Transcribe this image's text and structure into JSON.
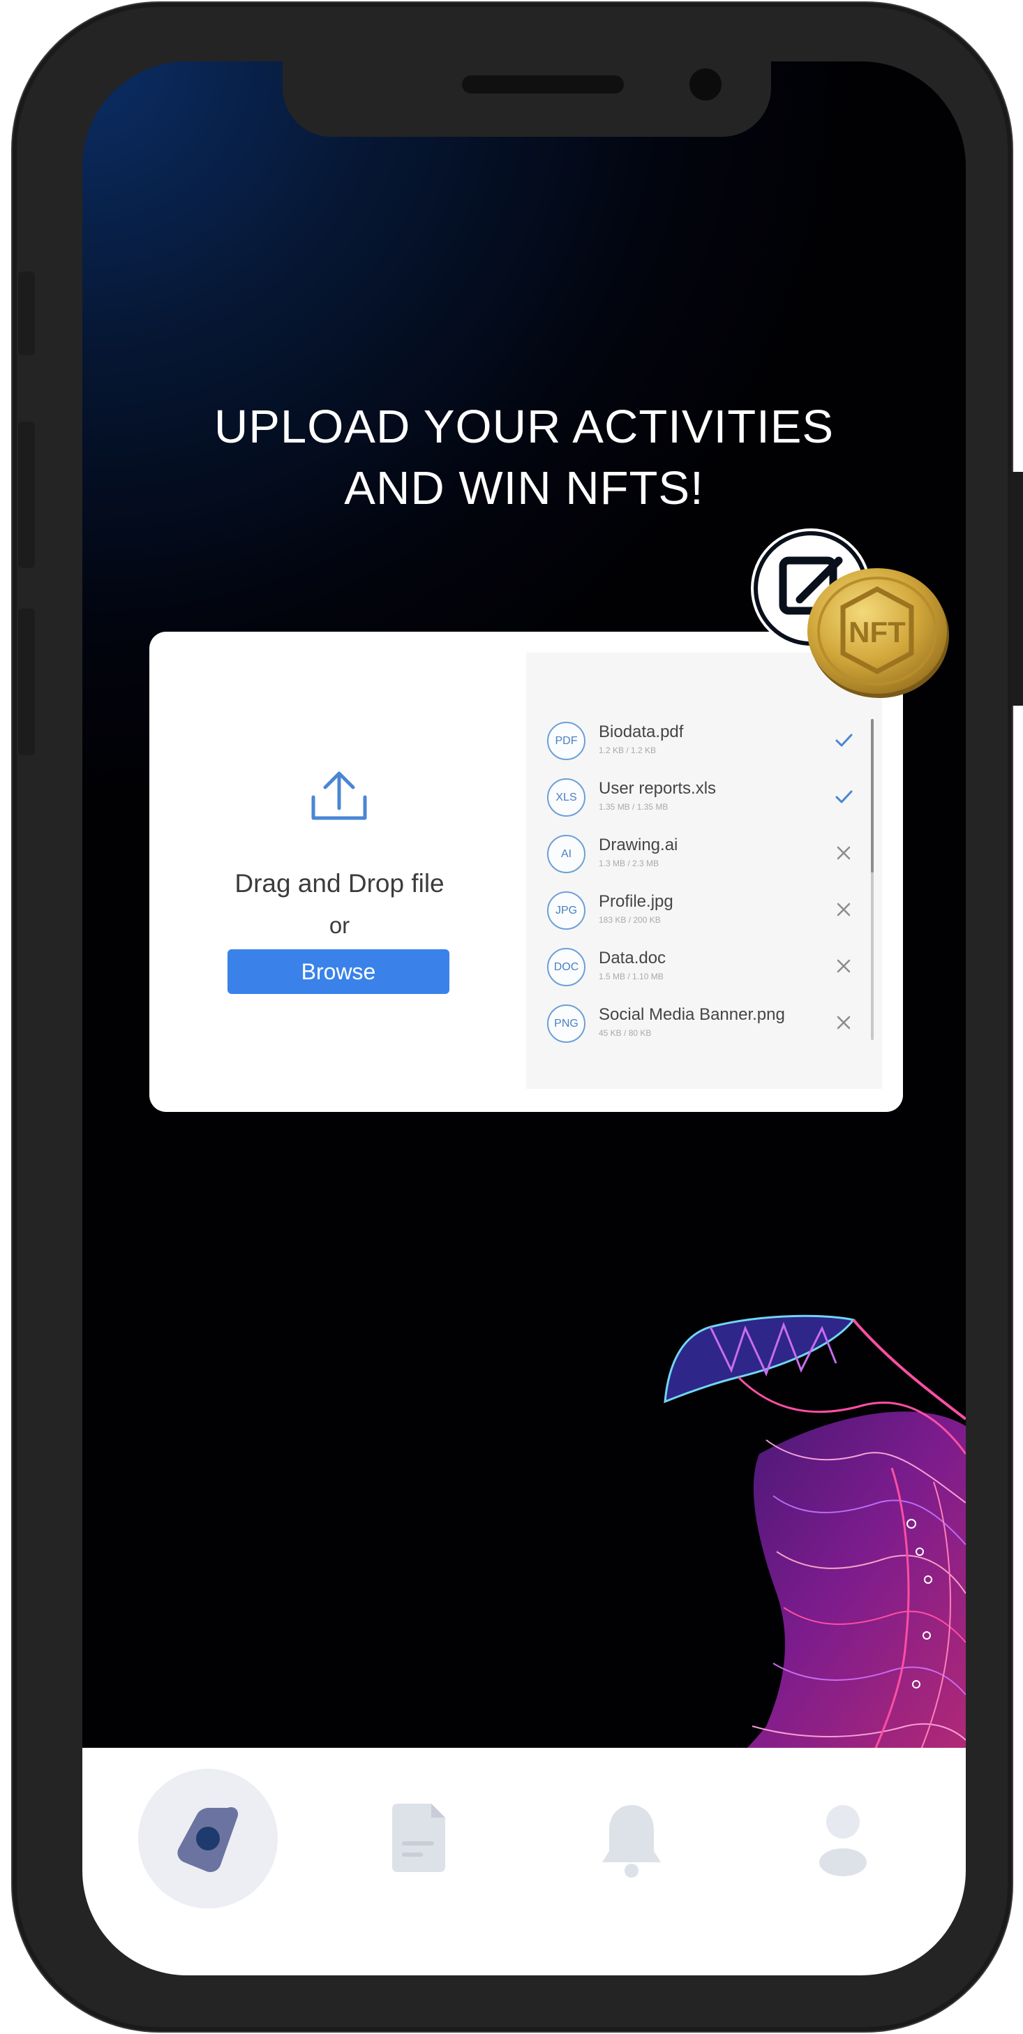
{
  "headline": {
    "line1": "UPLOAD YOUR ACTIVITIES",
    "line2": "AND WIN NFTS!"
  },
  "upload": {
    "drag_text": "Drag and Drop file",
    "or_text": "or",
    "browse_label": "Browse"
  },
  "files": [
    {
      "type": "PDF",
      "name": "Biodata.pdf",
      "size": "1.2 KB / 1.2 KB",
      "status": "check-icon"
    },
    {
      "type": "XLS",
      "name": "User reports.xls",
      "size": "1.35 MB / 1.35 MB",
      "status": "check-icon"
    },
    {
      "type": "AI",
      "name": "Drawing.ai",
      "size": "1.3 MB / 2.3 MB",
      "status": "close-icon"
    },
    {
      "type": "JPG",
      "name": "Profile.jpg",
      "size": "183 KB / 200 KB",
      "status": "close-icon"
    },
    {
      "type": "DOC",
      "name": "Data.doc",
      "size": "1.5 MB / 1.10 MB",
      "status": "close-icon"
    },
    {
      "type": "PNG",
      "name": "Social Media Banner.png",
      "size": "45 KB / 80 KB",
      "status": "close-icon"
    }
  ],
  "coin_text": "NFT",
  "nav": [
    {
      "name": "explore-icon",
      "active": true
    },
    {
      "name": "document-icon",
      "active": false
    },
    {
      "name": "bell-icon",
      "active": false
    },
    {
      "name": "profile-icon",
      "active": false
    }
  ],
  "colors": {
    "accent": "#3a82ea",
    "background_top": "#0b2e66",
    "background_bottom": "#010104",
    "coin_gold": "#d2a83c",
    "nav_active": "#1e3a6e",
    "nav_inactive": "#dde1e8"
  }
}
